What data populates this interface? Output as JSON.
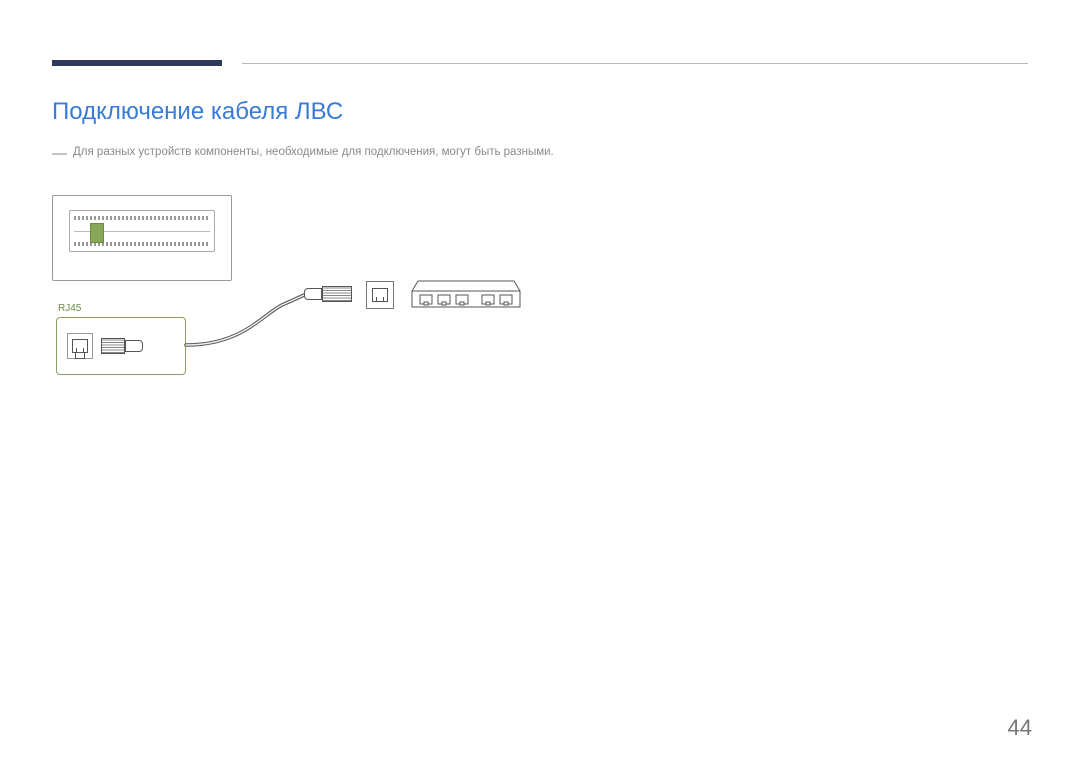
{
  "title": "Подключение кабеля ЛВС",
  "note_dash": "―",
  "note_text": "Для разных устройств компоненты, необходимые для подключения, могут быть разными.",
  "port_label": "RJ45",
  "page_number": "44"
}
